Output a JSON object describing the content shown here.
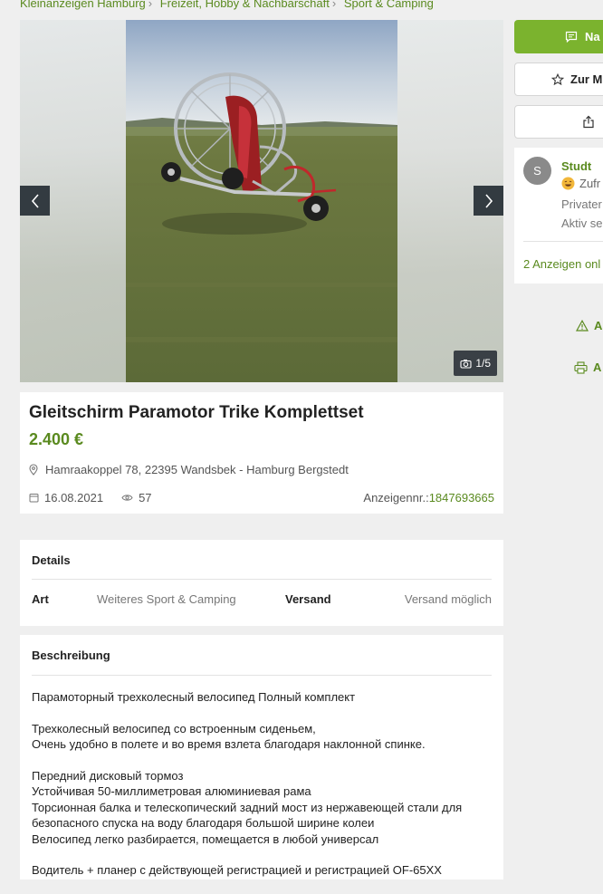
{
  "breadcrumb": [
    "Kleinanzeigen Hamburg",
    "Freizeit, Hobby & Nachbarschaft",
    "Sport & Camping"
  ],
  "gallery": {
    "counter": "1/5"
  },
  "ad": {
    "title": "Gleitschirm Paramotor Trike Komplettset",
    "price": "2.400 €",
    "location": "Hamraakoppel 78, 22395 Wandsbek - Hamburg Bergstedt",
    "date": "16.08.2021",
    "views": "57",
    "ad_number_label": "Anzeigennr.:",
    "ad_number": "1847693665"
  },
  "details": {
    "title": "Details",
    "art_label": "Art",
    "art_value": "Weiteres Sport & Camping",
    "versand_label": "Versand",
    "versand_value": "Versand möglich"
  },
  "description": {
    "title": "Beschreibung",
    "p1": "Парамоторный трехколесный велосипед Полный комплект",
    "p2": [
      "Трехколесный велосипед со встроенным сиденьем,",
      "Очень удобно в полете и во время взлета благодаря наклонной спинке."
    ],
    "p3": [
      "Передний дисковый тормоз",
      "Устойчивая 50-миллиметровая алюминиевая рама",
      "Торсионная балка и телескопический задний мост из нержавеющей стали для",
      "безопасного спуска на воду благодаря большой ширине колеи",
      "Велосипед легко разбирается, помещается в любой универсал"
    ],
    "p4": "Водитель + планер с действующей регистрацией и регистрацией OF-65XX"
  },
  "sidebar": {
    "primary_button": "Na",
    "watch_button": "Zur M",
    "seller_initial": "S",
    "seller_name": "Studt",
    "seller_rating": "Zufr",
    "seller_type": "Privater",
    "seller_active": "Aktiv se",
    "seller_ads": "2 Anzeigen onl",
    "report_link": "A",
    "print_link": "A"
  },
  "colors": {
    "accent": "#7bb32e",
    "link": "#5a8a1f",
    "nav": "#333b41"
  }
}
